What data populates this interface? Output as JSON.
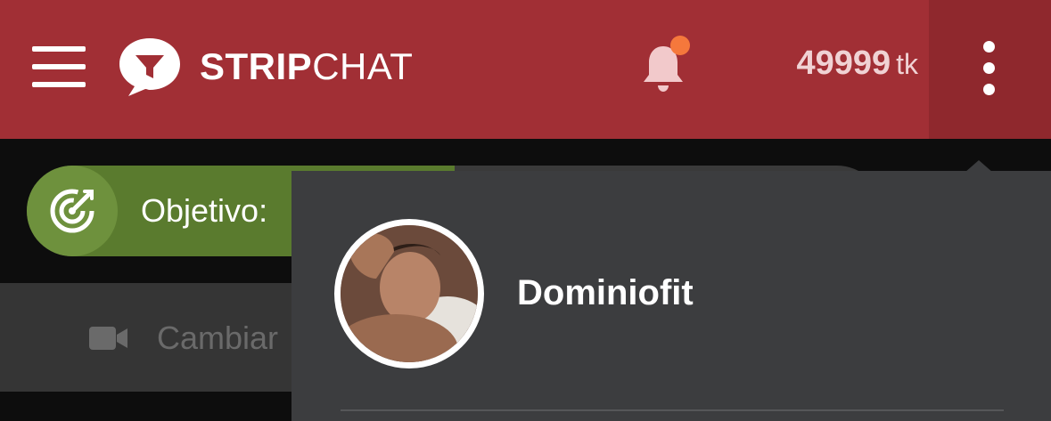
{
  "header": {
    "brand_bold": "STRIP",
    "brand_thin": "CHAT",
    "tokens_amount": "49999",
    "tokens_unit": "tk",
    "has_notification": true
  },
  "goal": {
    "label": "Objetivo:",
    "progress": 0.5,
    "icon": "target-icon"
  },
  "stream": {
    "camera_label": "Cambiar",
    "icon": "video-camera-icon"
  },
  "user_menu": {
    "username": "Dominiofit",
    "icon": "avatar"
  },
  "colors": {
    "header_bg": "#a12f35",
    "menu_bg": "#3c3d3f",
    "goal_fill": "#5a7b2e",
    "notification_dot": "#f5783c"
  }
}
